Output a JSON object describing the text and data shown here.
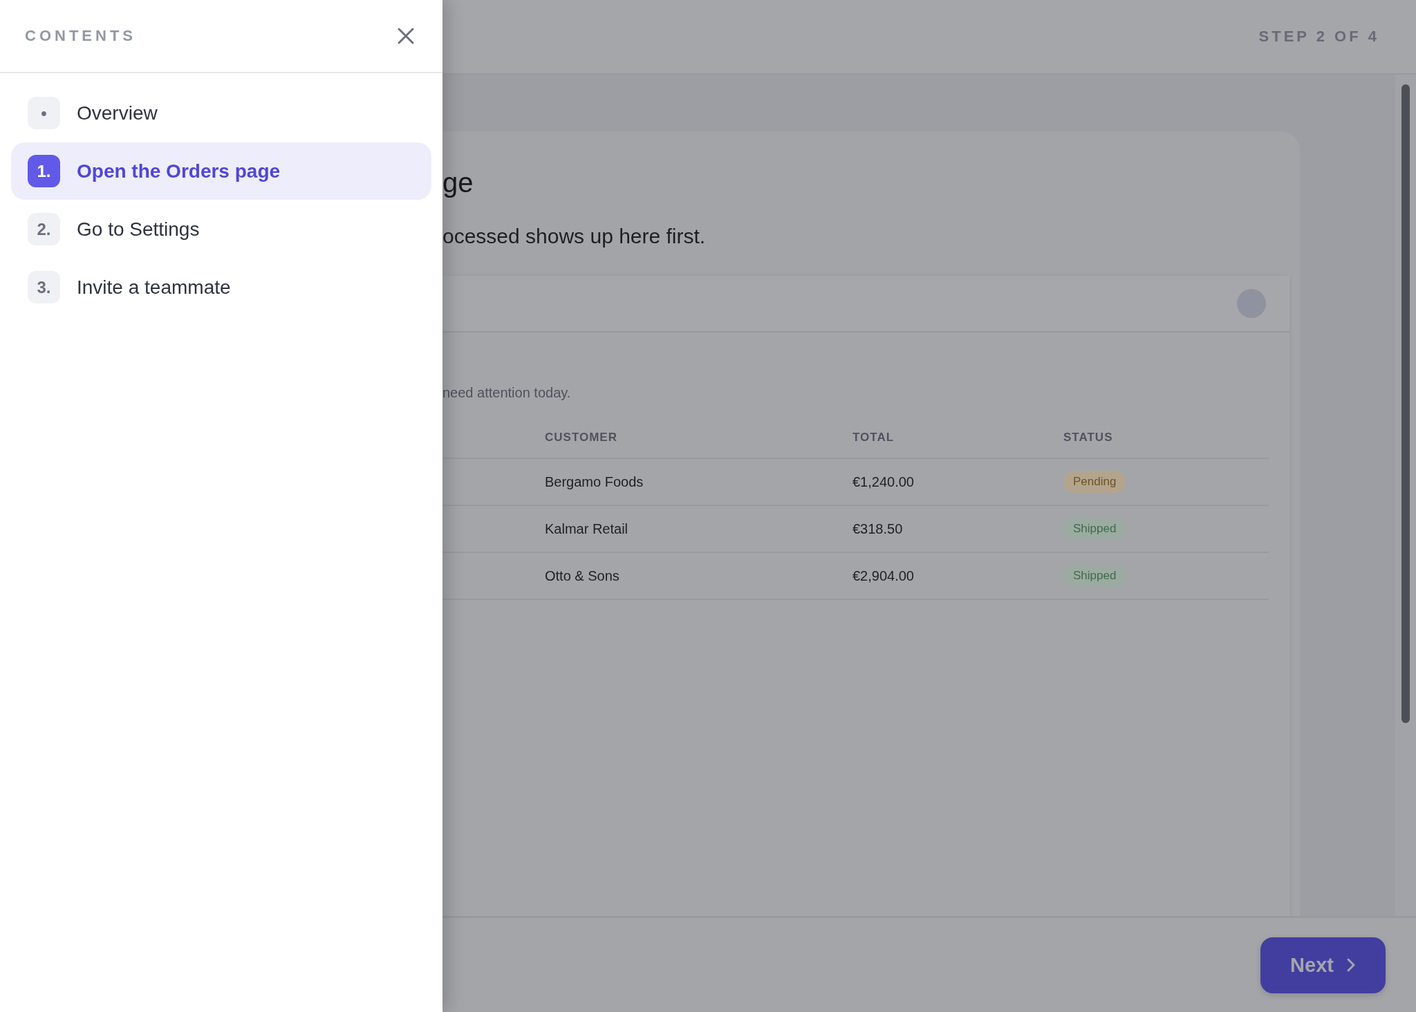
{
  "drawer": {
    "title": "CONTENTS",
    "items": [
      {
        "badge": "•",
        "label": "Overview",
        "selected": false
      },
      {
        "badge": "1.",
        "label": "Open the Orders page",
        "selected": true
      },
      {
        "badge": "2.",
        "label": "Go to Settings",
        "selected": false
      },
      {
        "badge": "3.",
        "label": "Invite a teammate",
        "selected": false
      }
    ]
  },
  "top_bar": {
    "step": "STEP 2 OF 4"
  },
  "card": {
    "heading": "ge",
    "subtitle": "ocessed shows up here first.",
    "panel_note": "need attention today.",
    "table": {
      "columns": [
        "CUSTOMER",
        "TOTAL",
        "STATUS"
      ],
      "rows": [
        {
          "customer": "Bergamo Foods",
          "total": "€1,240.00",
          "status": "Pending",
          "kind": "pending"
        },
        {
          "customer": "Kalmar Retail",
          "total": "€318.50",
          "status": "Shipped",
          "kind": "shipped"
        },
        {
          "customer": "Otto & Sons",
          "total": "€2,904.00",
          "status": "Shipped",
          "kind": "shipped"
        }
      ]
    }
  },
  "footer": {
    "next": "Next"
  }
}
